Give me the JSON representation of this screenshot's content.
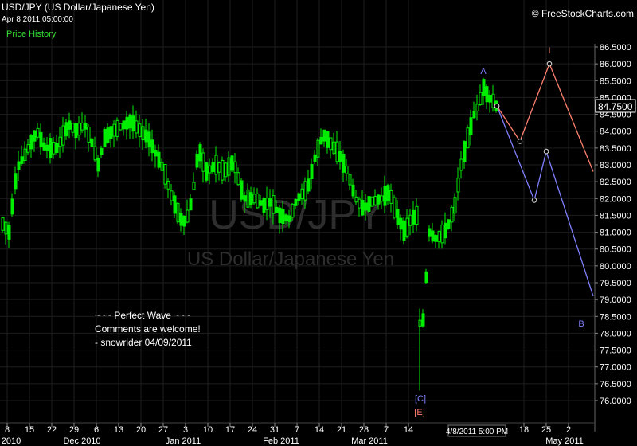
{
  "header": {
    "title": "USD/JPY (US Dollar/Japanese Yen)",
    "subtitle": "Apr 8 2011 05:00:00",
    "legend": "Price History",
    "copyright": "© FreeStockCharts.com"
  },
  "colors": {
    "background": "#000000",
    "candle": "#00ee00",
    "grid": "#1e1e1e",
    "wave_a": "#8080ff",
    "wave_i": "#ff8070",
    "watermark": "#2e2e2e"
  },
  "chart_data": {
    "type": "candlestick",
    "watermark": [
      "USD/JPY",
      "US Dollar/Japanese Yen"
    ],
    "ylim": [
      75.6,
      87.0
    ],
    "y_ticks": [
      "76.0000",
      "76.5000",
      "77.0000",
      "77.5000",
      "78.0000",
      "78.5000",
      "79.0000",
      "79.5000",
      "80.0000",
      "80.5000",
      "81.0000",
      "81.5000",
      "82.0000",
      "82.5000",
      "83.0000",
      "83.5000",
      "84.0000",
      "84.5000",
      "85.0000",
      "85.5000",
      "86.0000",
      "86.5000"
    ],
    "x_ticks": [
      "8",
      "15",
      "22",
      "29",
      "6",
      "13",
      "20",
      "27",
      "3",
      "10",
      "17",
      "24",
      "31",
      "7",
      "14",
      "21",
      "28",
      "7",
      "14",
      "18",
      "25",
      "2"
    ],
    "x_month_labels": [
      "2010",
      "Dec 2010",
      "Jan 2011",
      "Feb 2011",
      "Mar 2011",
      "May 2011"
    ],
    "last_price": "84.7500",
    "cursor_label": "4/8/2011 5:00 PM",
    "annotation": [
      "~~~ Perfect Wave ~~~",
      "Comments are welcome!",
      "- snowrider  04/09/2011"
    ],
    "price_path": [
      [
        0,
        81.3
      ],
      [
        10,
        81.0
      ],
      [
        20,
        82.9
      ],
      [
        30,
        83.3
      ],
      [
        45,
        84.0
      ],
      [
        55,
        83.5
      ],
      [
        70,
        83.5
      ],
      [
        85,
        84.2
      ],
      [
        95,
        84.0
      ],
      [
        105,
        84.2
      ],
      [
        115,
        83.6
      ],
      [
        122,
        83.0
      ],
      [
        130,
        83.8
      ],
      [
        140,
        84.0
      ],
      [
        155,
        84.2
      ],
      [
        163,
        84.3
      ],
      [
        175,
        84.0
      ],
      [
        185,
        83.8
      ],
      [
        195,
        83.3
      ],
      [
        205,
        82.8
      ],
      [
        215,
        82.0
      ],
      [
        225,
        81.4
      ],
      [
        232,
        81.3
      ],
      [
        240,
        82.0
      ],
      [
        248,
        83.5
      ],
      [
        258,
        82.8
      ],
      [
        270,
        83.0
      ],
      [
        280,
        82.8
      ],
      [
        292,
        83.1
      ],
      [
        305,
        82.0
      ],
      [
        318,
        82.0
      ],
      [
        330,
        81.8
      ],
      [
        340,
        81.9
      ],
      [
        350,
        81.5
      ],
      [
        362,
        81.4
      ],
      [
        372,
        82.0
      ],
      [
        385,
        82.3
      ],
      [
        395,
        83.3
      ],
      [
        405,
        83.9
      ],
      [
        415,
        83.6
      ],
      [
        425,
        83.3
      ],
      [
        435,
        82.8
      ],
      [
        445,
        82.0
      ],
      [
        455,
        81.7
      ],
      [
        465,
        81.9
      ],
      [
        478,
        82.0
      ],
      [
        488,
        82.2
      ],
      [
        497,
        81.5
      ],
      [
        507,
        81.0
      ],
      [
        515,
        81.4
      ],
      [
        522,
        81.5
      ],
      [
        527,
        77.5
      ],
      [
        532,
        79.0
      ],
      [
        538,
        81.0
      ],
      [
        545,
        80.8
      ],
      [
        552,
        80.9
      ],
      [
        560,
        81.1
      ],
      [
        570,
        81.8
      ],
      [
        578,
        83.0
      ],
      [
        586,
        83.8
      ],
      [
        594,
        84.5
      ],
      [
        600,
        84.8
      ],
      [
        606,
        85.3
      ],
      [
        612,
        85.0
      ],
      [
        618,
        84.9
      ],
      [
        622,
        84.75
      ]
    ],
    "spike_low": {
      "x": 527,
      "low": 76.3
    },
    "waves": [
      {
        "name": "I",
        "color": "#ff8070",
        "points": [
          [
            624,
            84.75
          ],
          [
            653,
            83.7
          ],
          [
            690,
            86.0
          ],
          [
            745,
            82.8
          ]
        ]
      },
      {
        "name": "B",
        "color": "#8080ff",
        "points": [
          [
            624,
            84.75
          ],
          [
            671,
            81.95
          ],
          [
            686,
            83.4
          ],
          [
            745,
            79.1
          ]
        ]
      }
    ],
    "labels": [
      {
        "text": "A",
        "color": "#8080ff"
      },
      {
        "text": "I",
        "color": "#ff8070"
      },
      {
        "text": "B",
        "color": "#8080ff"
      },
      {
        "text": "[C]",
        "color": "#8080ff"
      },
      {
        "text": "[E]",
        "color": "#ff8070"
      }
    ]
  }
}
